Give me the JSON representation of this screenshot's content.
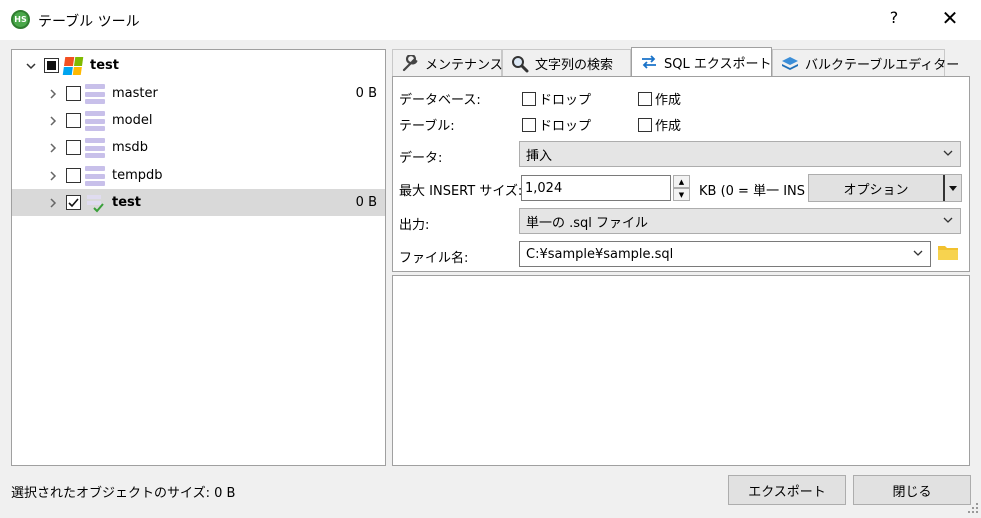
{
  "window": {
    "title": "テーブル ツール",
    "app_icon_text": "HS",
    "help": "?",
    "close": "✕"
  },
  "tree": {
    "root": {
      "label": "test",
      "checkbox": "partial",
      "expanded": true
    },
    "items": [
      {
        "label": "master",
        "size": "0 B",
        "checked": false,
        "selected": false
      },
      {
        "label": "model",
        "size": "",
        "checked": false,
        "selected": false
      },
      {
        "label": "msdb",
        "size": "",
        "checked": false,
        "selected": false
      },
      {
        "label": "tempdb",
        "size": "",
        "checked": false,
        "selected": false
      },
      {
        "label": "test",
        "size": "0 B",
        "checked": true,
        "selected": true
      }
    ]
  },
  "tabs": [
    {
      "label": "メンテナンス",
      "icon": "wrench-icon",
      "active": false
    },
    {
      "label": "文字列の検索",
      "icon": "magnifier-icon",
      "active": false
    },
    {
      "label": "SQL エクスポート",
      "icon": "export-arrows-icon",
      "active": true
    },
    {
      "label": "バルクテーブルエディター",
      "icon": "layers-icon",
      "active": false
    }
  ],
  "export": {
    "database_label": "データベース:",
    "table_label": "テーブル:",
    "drop_label": "ドロップ",
    "create_label": "作成",
    "data_label": "データ:",
    "data_value": "挿入",
    "max_insert_label": "最大 INSERT サイズ:",
    "max_insert_value": "1,024",
    "kb_hint": "KB (0 = 単一 INS",
    "options_button": "オプション",
    "output_label": "出力:",
    "output_value": "単一の .sql ファイル",
    "filename_label": "ファイル名:",
    "filename_value": "C:¥sample¥sample.sql"
  },
  "footer": {
    "status": "選択されたオブジェクトのサイズ: 0 B",
    "export_button": "エクスポート",
    "close_button": "閉じる"
  },
  "colors": {
    "db_icon": "#c8c0ea",
    "selection": "#d9d9d9",
    "accent_blue": "#1a73c9",
    "folder": "#f2c12e"
  }
}
